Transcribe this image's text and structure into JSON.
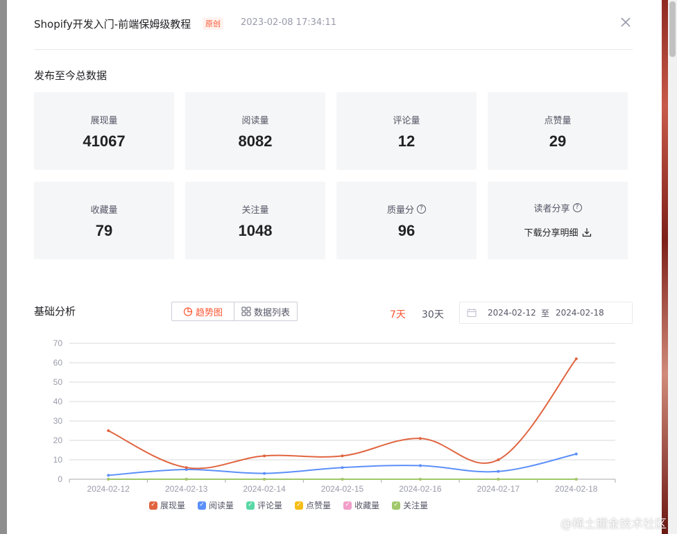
{
  "header": {
    "title": "Shopify开发入门-前端保姆级教程",
    "badge": "原创",
    "publish_time": "2023-02-08 17:34:11"
  },
  "totals": {
    "section_title": "发布至今总数据",
    "cards": [
      {
        "label": "展现量",
        "value": "41067"
      },
      {
        "label": "阅读量",
        "value": "8082"
      },
      {
        "label": "评论量",
        "value": "12"
      },
      {
        "label": "点赞量",
        "value": "29"
      },
      {
        "label": "收藏量",
        "value": "79"
      },
      {
        "label": "关注量",
        "value": "1048"
      },
      {
        "label": "质量分",
        "value": "96",
        "help": true
      },
      {
        "label": "读者分享",
        "link": "下载分享明细",
        "help": true
      }
    ]
  },
  "analysis": {
    "section_title": "基础分析",
    "view_toggle": {
      "trend": "趋势图",
      "list": "数据列表"
    },
    "ranges": [
      "7天",
      "30天"
    ],
    "active_range": "7天",
    "date_range": {
      "start": "2024-02-12",
      "separator": "至",
      "end": "2024-02-18"
    }
  },
  "colors": {
    "accent": "#fc5531",
    "views": "#e0643f",
    "reads": "#5b8ff9",
    "comments": "#5ad8a6",
    "likes": "#f6bd16",
    "favorites": "#f29ec9",
    "follows": "#a0c86a"
  },
  "chart_data": {
    "type": "line",
    "categories": [
      "2024-02-12",
      "2024-02-13",
      "2024-02-14",
      "2024-02-15",
      "2024-02-16",
      "2024-02-17",
      "2024-02-18"
    ],
    "ylim": [
      0,
      70
    ],
    "yticks": [
      0,
      10,
      20,
      30,
      40,
      50,
      60,
      70
    ],
    "grid": true,
    "legend_position": "bottom",
    "series": [
      {
        "name": "展现量",
        "values": [
          25,
          6,
          12,
          12,
          21,
          10,
          62
        ],
        "color": "#e0643f"
      },
      {
        "name": "阅读量",
        "values": [
          2,
          5,
          3,
          6,
          7,
          4,
          13
        ],
        "color": "#5b8ff9"
      },
      {
        "name": "评论量",
        "values": [
          0,
          0,
          0,
          0,
          0,
          0,
          0
        ],
        "color": "#5ad8a6"
      },
      {
        "name": "点赞量",
        "values": [
          0,
          0,
          0,
          0,
          0,
          0,
          0
        ],
        "color": "#f6bd16"
      },
      {
        "name": "收藏量",
        "values": [
          0,
          0,
          0,
          0,
          0,
          0,
          0
        ],
        "color": "#f29ec9"
      },
      {
        "name": "关注量",
        "values": [
          0,
          0,
          0,
          0,
          0,
          0,
          0
        ],
        "color": "#a0c86a"
      }
    ]
  },
  "watermark": "@稀土掘金技术社区"
}
